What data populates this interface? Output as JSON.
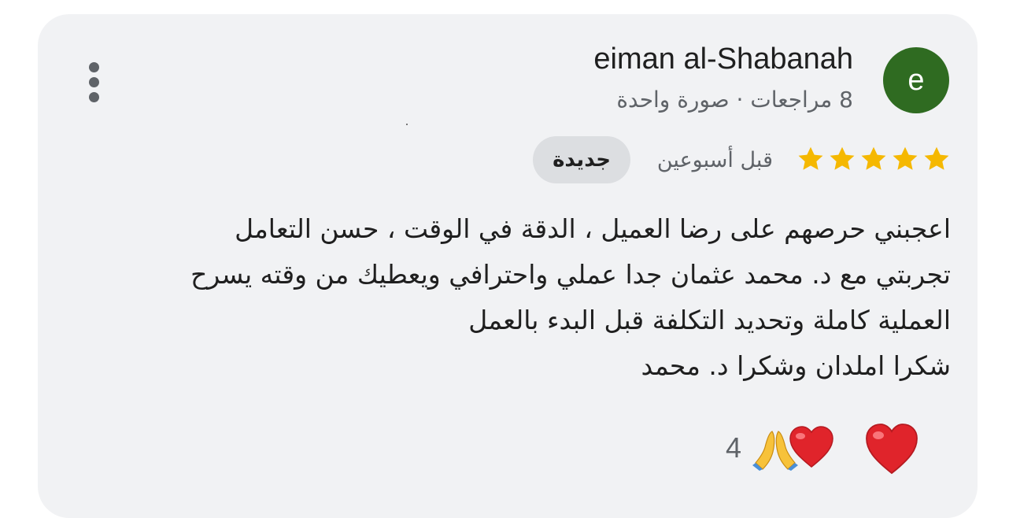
{
  "author": {
    "avatar_letter": "e",
    "avatar_color": "#2f6b21",
    "name": "eiman al-Shabanah",
    "meta": "8 مراجعات · صورة واحدة"
  },
  "review": {
    "rating": 5,
    "star_color": "#f5b800",
    "time": "قبل أسبوعين",
    "badge": "جديدة",
    "lines": [
      "اعجبني حرصهم على رضا العميل ، الدقة في الوقت ، حسن التعامل",
      "تجربتي مع د. محمد عثمان جدا عملي واحترافي ويعطيك من وقته يسرح",
      "العملية كاملة وتحديد التكلفة قبل البدء بالعمل",
      "شكرا املدان وشكرا د. محمد"
    ]
  },
  "reactions": {
    "count": "4",
    "icons": [
      "pray-icon",
      "heart-icon"
    ],
    "react_button_icon": "heart-icon",
    "heart_color": "#e0242b"
  },
  "menu_icon": "more-vertical-icon"
}
